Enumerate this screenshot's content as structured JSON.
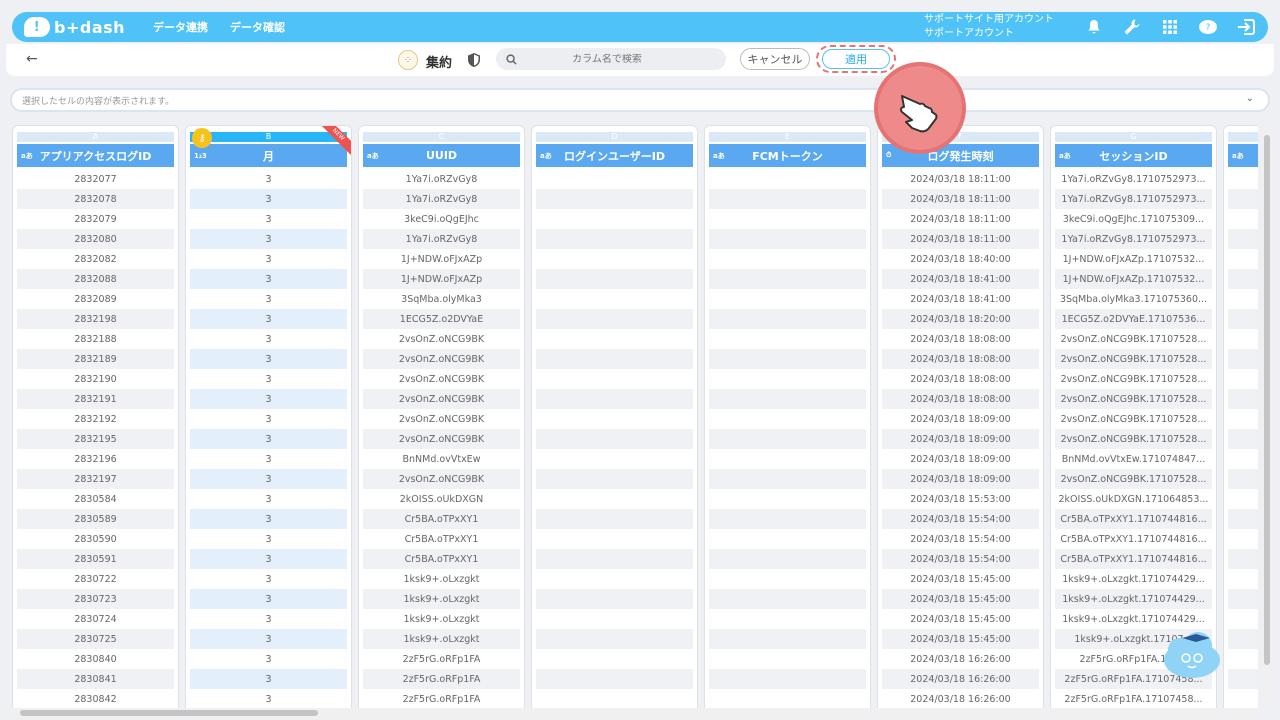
{
  "nav": {
    "logo": "b+dash",
    "links": [
      "データ連携",
      "データ確認"
    ],
    "account_line1": "サポートサイト用アカウント",
    "account_line2": "サポートアカウント"
  },
  "toolbar": {
    "aggregate_label": "集約",
    "search_placeholder": "カラム名で検索",
    "cancel_label": "キャンセル",
    "apply_label": "適用"
  },
  "cellbar": {
    "placeholder": "選択したセルの内容が表示されます。"
  },
  "columns": [
    {
      "letter": "A",
      "type": "aあ",
      "title": "アプリアクセスログID"
    },
    {
      "letter": "B",
      "type": "1₂3",
      "title": "月"
    },
    {
      "letter": "C",
      "type": "aあ",
      "title": "UUID"
    },
    {
      "letter": "D",
      "type": "aあ",
      "title": "ログインユーザーID"
    },
    {
      "letter": "E",
      "type": "aあ",
      "title": "FCMトークン"
    },
    {
      "letter": "F",
      "type": "⏱",
      "title": "ログ発生時刻"
    },
    {
      "letter": "G",
      "type": "aあ",
      "title": "セッションID"
    },
    {
      "letter": "",
      "type": "aあ",
      "title": ""
    }
  ],
  "new_badge": "NEW",
  "rows": [
    [
      "2832077",
      "3",
      "1Ya7i.oRZvGy8",
      "",
      "",
      "2024/03/18 18:11:00",
      "1Ya7i.oRZvGy8.1710752973..."
    ],
    [
      "2832078",
      "3",
      "1Ya7i.oRZvGy8",
      "",
      "",
      "2024/03/18 18:11:00",
      "1Ya7i.oRZvGy8.1710752973..."
    ],
    [
      "2832079",
      "3",
      "3keC9i.oQgEJhc",
      "",
      "",
      "2024/03/18 18:11:00",
      "3keC9i.oQgEJhc.171075309..."
    ],
    [
      "2832080",
      "3",
      "1Ya7i.oRZvGy8",
      "",
      "",
      "2024/03/18 18:11:00",
      "1Ya7i.oRZvGy8.1710752973..."
    ],
    [
      "2832082",
      "3",
      "1J+NDW.oFJxAZp",
      "",
      "",
      "2024/03/18 18:40:00",
      "1J+NDW.oFJxAZp.17107532..."
    ],
    [
      "2832088",
      "3",
      "1J+NDW.oFJxAZp",
      "",
      "",
      "2024/03/18 18:41:00",
      "1J+NDW.oFJxAZp.17107532..."
    ],
    [
      "2832089",
      "3",
      "3SqMba.olyMka3",
      "",
      "",
      "2024/03/18 18:41:00",
      "3SqMba.olyMka3.171075360..."
    ],
    [
      "2832198",
      "3",
      "1ECG5Z.o2DVYaE",
      "",
      "",
      "2024/03/18 18:20:00",
      "1ECG5Z.o2DVYaE.17107536..."
    ],
    [
      "2832188",
      "3",
      "2vsOnZ.oNCG9BK",
      "",
      "",
      "2024/03/18 18:08:00",
      "2vsOnZ.oNCG9BK.17107528..."
    ],
    [
      "2832189",
      "3",
      "2vsOnZ.oNCG9BK",
      "",
      "",
      "2024/03/18 18:08:00",
      "2vsOnZ.oNCG9BK.17107528..."
    ],
    [
      "2832190",
      "3",
      "2vsOnZ.oNCG9BK",
      "",
      "",
      "2024/03/18 18:08:00",
      "2vsOnZ.oNCG9BK.17107528..."
    ],
    [
      "2832191",
      "3",
      "2vsOnZ.oNCG9BK",
      "",
      "",
      "2024/03/18 18:08:00",
      "2vsOnZ.oNCG9BK.17107528..."
    ],
    [
      "2832192",
      "3",
      "2vsOnZ.oNCG9BK",
      "",
      "",
      "2024/03/18 18:09:00",
      "2vsOnZ.oNCG9BK.17107528..."
    ],
    [
      "2832195",
      "3",
      "2vsOnZ.oNCG9BK",
      "",
      "",
      "2024/03/18 18:09:00",
      "2vsOnZ.oNCG9BK.17107528..."
    ],
    [
      "2832196",
      "3",
      "BnNMd.ovVtxEw",
      "",
      "",
      "2024/03/18 18:09:00",
      "BnNMd.ovVtxEw.171074847..."
    ],
    [
      "2832197",
      "3",
      "2vsOnZ.oNCG9BK",
      "",
      "",
      "2024/03/18 18:09:00",
      "2vsOnZ.oNCG9BK.17107528..."
    ],
    [
      "2830584",
      "3",
      "2kOISS.oUkDXGN",
      "",
      "",
      "2024/03/18 15:53:00",
      "2kOISS.oUkDXGN.171064853..."
    ],
    [
      "2830589",
      "3",
      "Cr5BA.oTPxXY1",
      "",
      "",
      "2024/03/18 15:54:00",
      "Cr5BA.oTPxXY1.1710744816..."
    ],
    [
      "2830590",
      "3",
      "Cr5BA.oTPxXY1",
      "",
      "",
      "2024/03/18 15:54:00",
      "Cr5BA.oTPxXY1.1710744816..."
    ],
    [
      "2830591",
      "3",
      "Cr5BA.oTPxXY1",
      "",
      "",
      "2024/03/18 15:54:00",
      "Cr5BA.oTPxXY1.1710744816..."
    ],
    [
      "2830722",
      "3",
      "1ksk9+.oLxzgkt",
      "",
      "",
      "2024/03/18 15:45:00",
      "1ksk9+.oLxzgkt.171074429..."
    ],
    [
      "2830723",
      "3",
      "1ksk9+.oLxzgkt",
      "",
      "",
      "2024/03/18 15:45:00",
      "1ksk9+.oLxzgkt.171074429..."
    ],
    [
      "2830724",
      "3",
      "1ksk9+.oLxzgkt",
      "",
      "",
      "2024/03/18 15:45:00",
      "1ksk9+.oLxzgkt.171074429..."
    ],
    [
      "2830725",
      "3",
      "1ksk9+.oLxzgkt",
      "",
      "",
      "2024/03/18 15:45:00",
      "1ksk9+.oLxzgkt.17107..."
    ],
    [
      "2830840",
      "3",
      "2zF5rG.oRFp1FA",
      "",
      "",
      "2024/03/18 16:26:00",
      "2zF5rG.oRFp1FA.171..."
    ],
    [
      "2830841",
      "3",
      "2zF5rG.oRFp1FA",
      "",
      "",
      "2024/03/18 16:26:00",
      "2zF5rG.oRFp1FA.17107458..."
    ],
    [
      "2830842",
      "3",
      "2zF5rG.oRFp1FA",
      "",
      "",
      "2024/03/18 16:26:00",
      "2zF5rG.oRFp1FA.17107458..."
    ]
  ]
}
